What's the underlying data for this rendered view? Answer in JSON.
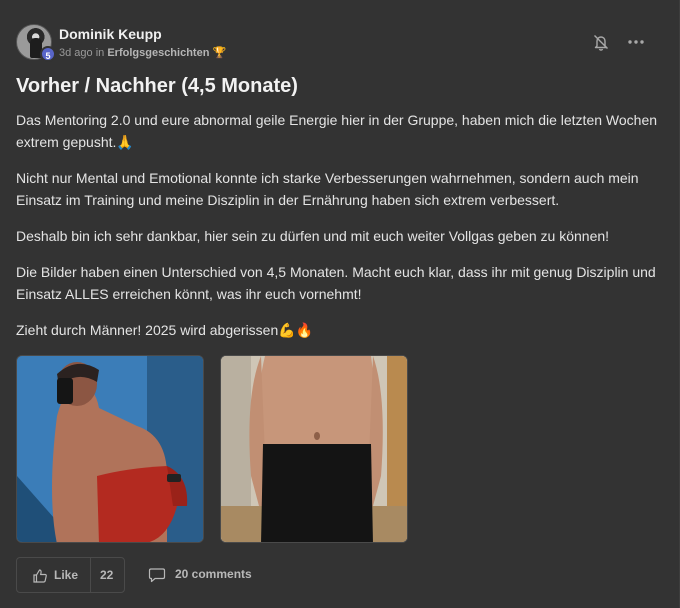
{
  "post": {
    "author": "Dominik Keupp",
    "level": "5",
    "time_ago": "3d ago",
    "in_word": "in",
    "category": "Erfolgsgeschichten",
    "category_emoji": "🏆",
    "title": "Vorher / Nachher (4,5 Monate)",
    "paragraphs": [
      "Das Mentoring 2.0 und eure abnormal geile Energie hier in der Gruppe, haben mich die letzten Wochen extrem gepusht.🙏",
      "Nicht nur Mental und Emotional konnte ich starke Verbesserungen wahrnehmen, sondern auch mein Einsatz im Training und meine Disziplin in der Ernährung haben sich extrem verbessert.",
      "Deshalb bin ich sehr dankbar, hier sein zu dürfen und mit euch weiter Vollgas geben zu können!",
      "Die Bilder haben einen Unterschied von 4,5 Monaten. Macht euch klar, dass ihr mit genug Disziplin und Einsatz ALLES erreichen könnt, was ihr euch vornehmt!",
      "Zieht durch Männer! 2025 wird abgerissen💪🔥"
    ]
  },
  "icons": {
    "bell": "bell-off-icon",
    "more": "more-horizontal-icon",
    "like": "thumbs-up-icon",
    "comment": "comment-icon"
  },
  "footer": {
    "like_label": "Like",
    "like_count": "22",
    "comments_label": "20 comments"
  },
  "colors": {
    "background": "#333333",
    "level_badge": "#5865c9",
    "muted_text": "#9a9a9a"
  }
}
